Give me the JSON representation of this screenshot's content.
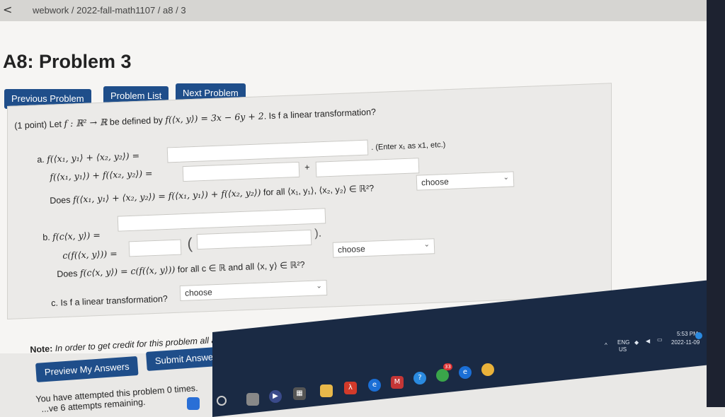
{
  "browser": {
    "back_glyph": "<",
    "breadcrumb": "webwork / 2022-fall-math1107 / a8 / 3"
  },
  "page_title": "A8: Problem 3",
  "nav": {
    "previous": "Previous Problem",
    "list": "Problem List",
    "next": "Next Problem"
  },
  "problem": {
    "intro_prefix": "(1 point) Let ",
    "intro_math": "f : ℝ² → ℝ",
    "intro_mid": " be defined by ",
    "intro_formula": "f(⟨x, y⟩) = 3x − 6y + 2",
    "intro_suffix": ". Is f a linear transformation?",
    "a": {
      "label": "a.",
      "line1": "f(⟨x₁, y₁⟩ + ⟨x₂, y₂⟩) =",
      "hint": ". (Enter x₁ as x1, etc.)",
      "line2": "f(⟨x₁, y₁⟩) + f(⟨x₂, y₂⟩) =",
      "plus": "+",
      "question_prefix": "Does ",
      "question_math": "f(⟨x₁, y₁⟩ + ⟨x₂, y₂⟩) = f(⟨x₁, y₁⟩) + f(⟨x₂, y₂⟩)",
      "question_suffix": " for all ⟨x₁, y₁⟩, ⟨x₂, y₂⟩ ∈ ℝ²?",
      "select": "choose"
    },
    "b": {
      "label": "b.",
      "line1": "f(c⟨x, y⟩) =",
      "line2": "c(f(⟨x, y⟩)) =",
      "open_paren": "(",
      "close_paren": ").",
      "question_prefix": "Does ",
      "question_math": "f(c⟨x, y⟩) = c(f(⟨x, y⟩))",
      "question_suffix": " for all c ∈ ℝ and all ⟨x, y⟩ ∈ ℝ²?",
      "select": "choose"
    },
    "c": {
      "label": "c.",
      "question": "Is f a linear transformation?",
      "select": "choose"
    }
  },
  "note": {
    "bold": "Note:",
    "text": " In order to get credit for this problem all answers must be correct."
  },
  "actions": {
    "preview": "Preview My Answers",
    "submit": "Submit Answers"
  },
  "status": {
    "attempts": "You have attempted this problem 0 times.",
    "remaining": "...ve 6 attempts remaining."
  },
  "tray": {
    "lang1": "ENG",
    "lang2": "US",
    "time": "5:53 PM",
    "date": "2022-11-09",
    "badge": "33"
  },
  "colors": {
    "button": "#1f4e8a",
    "taskbar": "#1a2a44"
  }
}
